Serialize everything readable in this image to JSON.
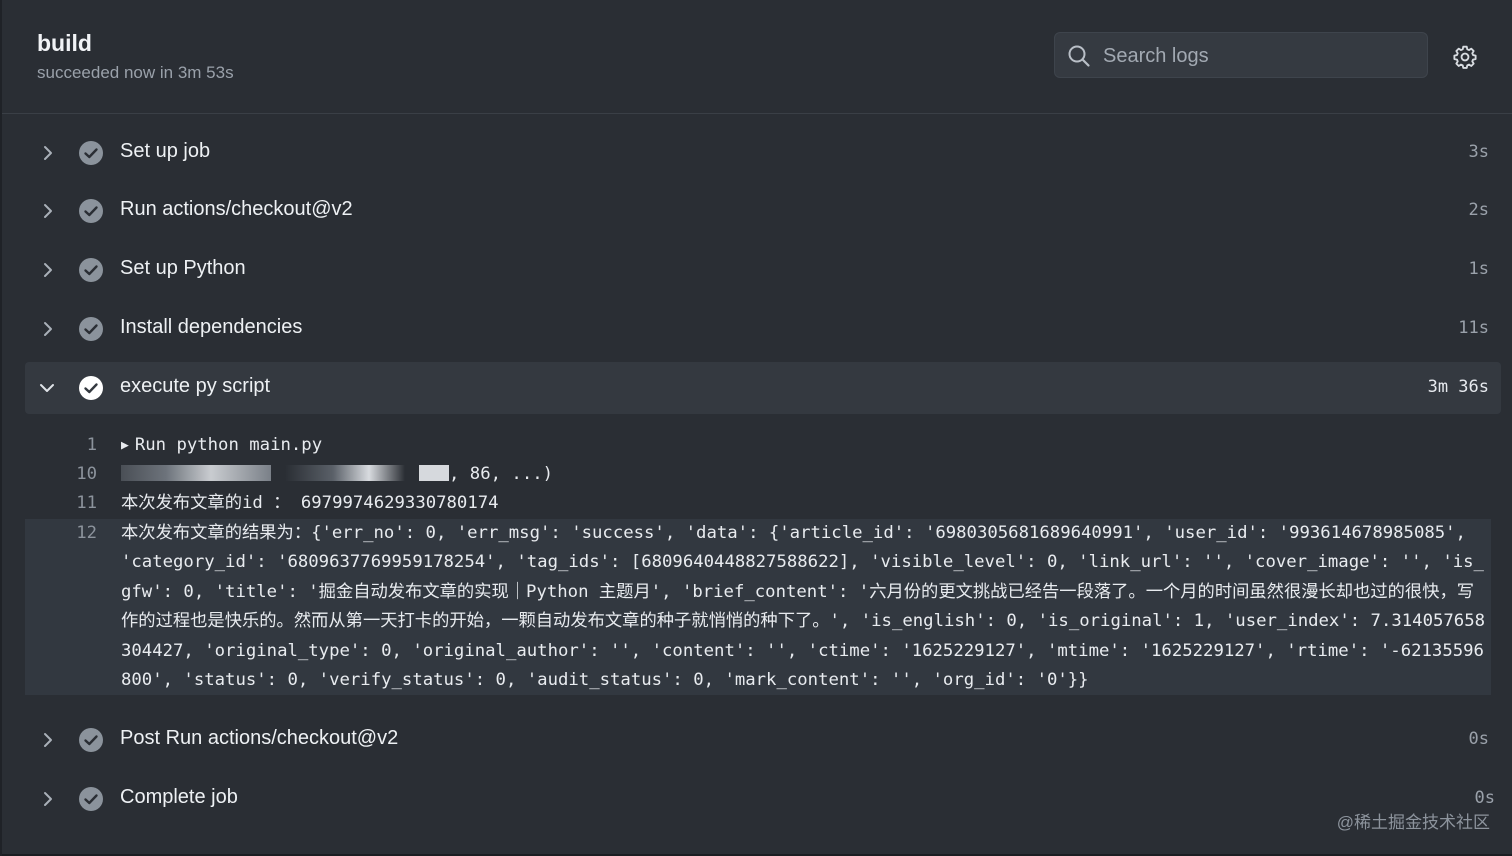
{
  "job": {
    "title": "build",
    "status": "succeeded now in 3m 53s"
  },
  "search": {
    "placeholder": "Search logs"
  },
  "steps": [
    {
      "label": "Set up job",
      "time": "3s"
    },
    {
      "label": "Run actions/checkout@v2",
      "time": "2s"
    },
    {
      "label": "Set up Python",
      "time": "1s"
    },
    {
      "label": "Install dependencies",
      "time": "11s"
    },
    {
      "label": "execute py script",
      "time": "3m 36s",
      "expanded": true
    },
    {
      "label": "Post Run actions/checkout@v2",
      "time": "0s"
    },
    {
      "label": "Complete job",
      "time": "0s"
    }
  ],
  "log": [
    {
      "num": "1",
      "text": "Run python main.py"
    },
    {
      "num": "10",
      "text": ", 86, ...)"
    },
    {
      "num": "11",
      "text": "本次发布文章的id ： 6979974629330780174"
    },
    {
      "num": "12",
      "text": "本次发布文章的结果为：{'err_no': 0, 'err_msg': 'success', 'data': {'article_id': '6980305681689640991', 'user_id': '993614678985085', 'category_id': '6809637769959178254', 'tag_ids': [6809640448827588622], 'visible_level': 0, 'link_url': '', 'cover_image': '', 'is_gfw': 0, 'title': '掘金自动发布文章的实现｜Python 主题月', 'brief_content': '六月份的更文挑战已经告一段落了。一个月的时间虽然很漫长却也过的很快，写作的过程也是快乐的。然而从第一天打卡的开始，一颗自动发布文章的种子就悄悄的种下了。', 'is_english': 0, 'is_original': 1, 'user_index': 7.314057658304427, 'original_type': 0, 'original_author': '', 'content': '', 'ctime': '1625229127', 'mtime': '1625229127', 'rtime': '-62135596800', 'status': 0, 'verify_status': 0, 'audit_status': 0, 'mark_content': '', 'org_id': '0'}}"
    }
  ],
  "watermark": "@稀土掘金技术社区",
  "icons": {
    "search": "search-icon",
    "settings": "gear-icon",
    "collapsed": "chevron-right-icon",
    "expanded": "chevron-down-icon",
    "success": "check-circle-icon",
    "log_expand": "triangle-right-icon"
  },
  "colors": {
    "background": "#2a2e34",
    "check_done": "#8b939c",
    "check_active": "#ffffff",
    "muted_text": "#9aa1aa"
  }
}
